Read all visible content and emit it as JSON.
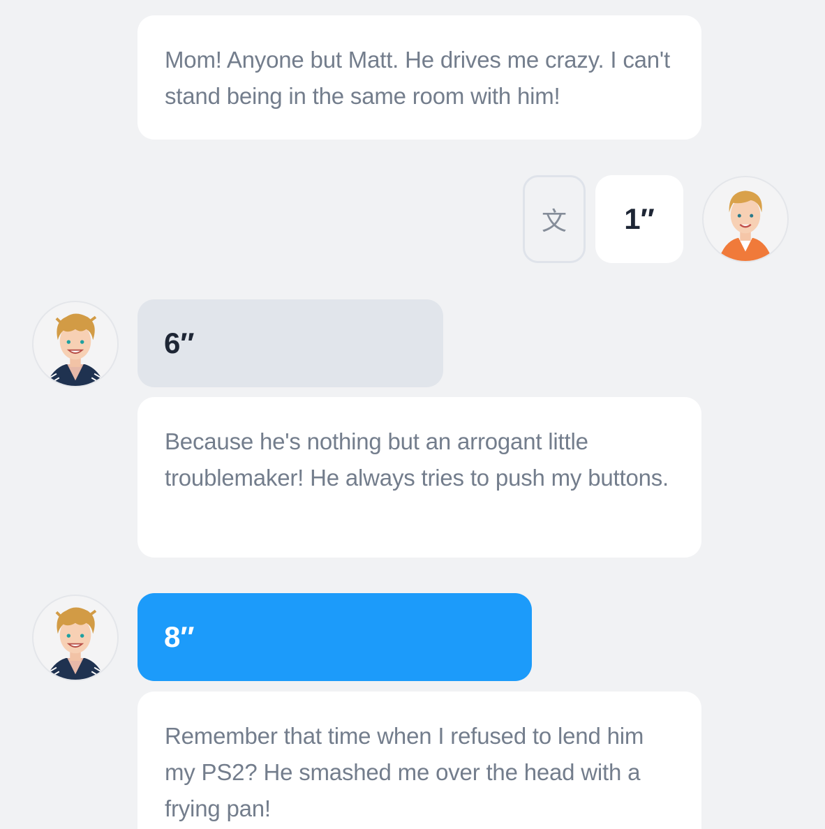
{
  "messages": [
    {
      "text": "Mom! Anyone but Matt. He drives me crazy. I can't stand being in the same room with him!"
    },
    {
      "text": "Because he's nothing but an arrogant little troublemaker! He always tries to push my buttons."
    },
    {
      "text": "Remember that time when I refused to lend him my PS2? He smashed me over the head with a frying pan!"
    }
  ],
  "audio": {
    "mine_duration": "1″",
    "first_duration": "6″",
    "second_duration": "8″"
  },
  "translate": {
    "icon_glyph": "文",
    "icon": "translate-icon"
  },
  "colors": {
    "background": "#f1f2f4",
    "card": "#ffffff",
    "text": "#737d8c",
    "audio_gray": "#e1e5eb",
    "audio_active": "#1c9bfa"
  }
}
